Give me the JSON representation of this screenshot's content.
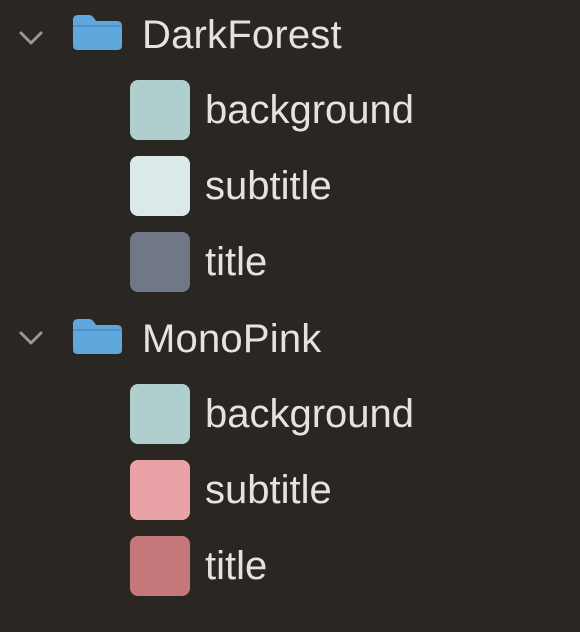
{
  "groups": [
    {
      "label": "DarkForest",
      "icon": "folder-icon",
      "expanded": true,
      "items": [
        {
          "label": "background",
          "color": "#aecfcd"
        },
        {
          "label": "subtitle",
          "color": "#dce9e9"
        },
        {
          "label": "title",
          "color": "#707787"
        }
      ]
    },
    {
      "label": "MonoPink",
      "icon": "folder-icon",
      "expanded": true,
      "items": [
        {
          "label": "background",
          "color": "#aecfcd"
        },
        {
          "label": "subtitle",
          "color": "#e9a3a6"
        },
        {
          "label": "title",
          "color": "#c47879"
        }
      ]
    }
  ],
  "colors": {
    "background": "#2a2723",
    "text": "#e6e3df",
    "folder": "#5fa8de",
    "chevron": "#9a9692"
  }
}
